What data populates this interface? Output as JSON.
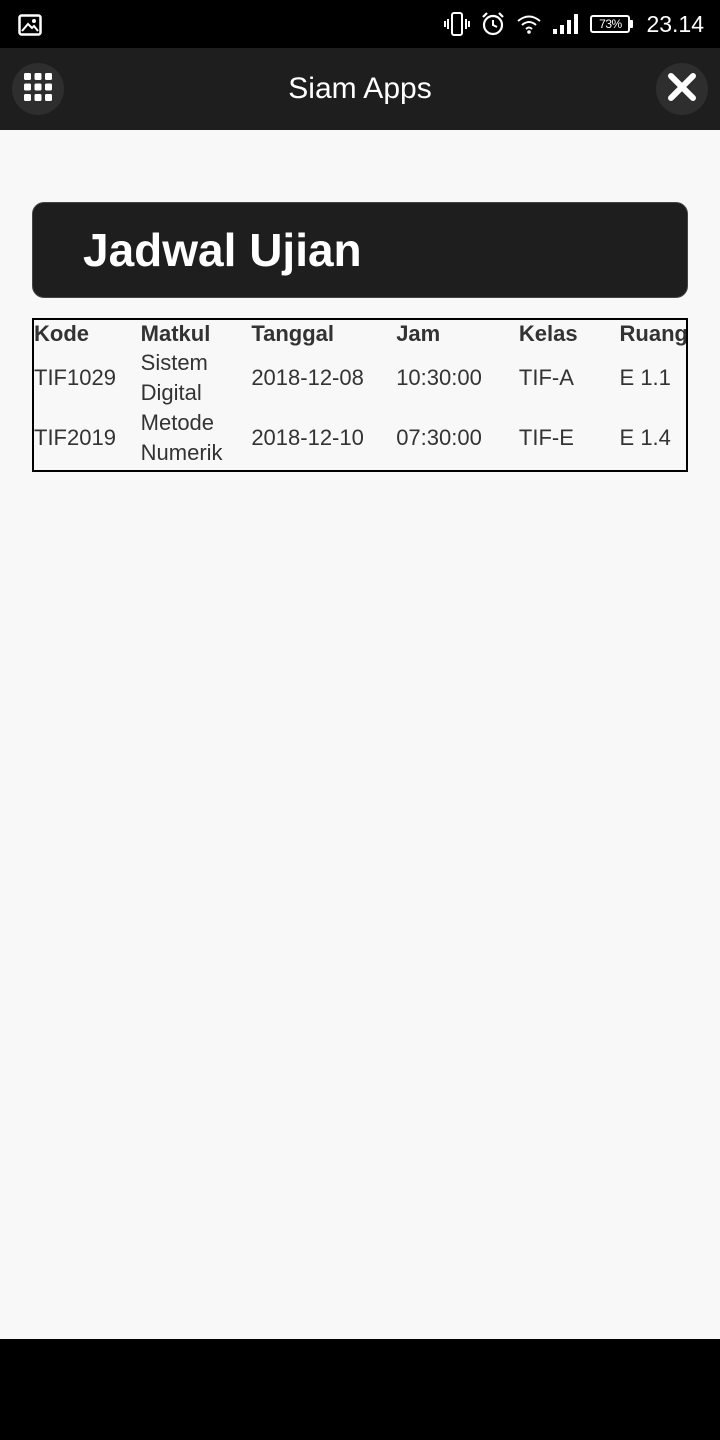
{
  "status_bar": {
    "battery": "73%",
    "time": "23.14"
  },
  "app_bar": {
    "title": "Siam Apps"
  },
  "page": {
    "heading": "Jadwal Ujian"
  },
  "table": {
    "headers": [
      "Kode",
      "Matkul",
      "Tanggal",
      "Jam",
      "Kelas",
      "Ruang"
    ],
    "rows": [
      {
        "kode": "TIF1029",
        "matkul_line1": "Sistem",
        "matkul_line2": "Digital",
        "tanggal": "2018-12-08",
        "jam": "10:30:00",
        "kelas": "TIF-A",
        "ruang": "E 1.1"
      },
      {
        "kode": "TIF2019",
        "matkul_line1": "Metode",
        "matkul_line2": "Numerik",
        "tanggal": "2018-12-10",
        "jam": "07:30:00",
        "kelas": "TIF-E",
        "ruang": "E 1.4"
      }
    ]
  },
  "icons": {
    "status_left": "image-icon",
    "status_right": [
      "vibrate-icon",
      "alarm-icon",
      "wifi-icon",
      "signal-icon",
      "battery-icon"
    ],
    "app_bar_left": "grid-menu-icon",
    "app_bar_right": "close-icon"
  }
}
